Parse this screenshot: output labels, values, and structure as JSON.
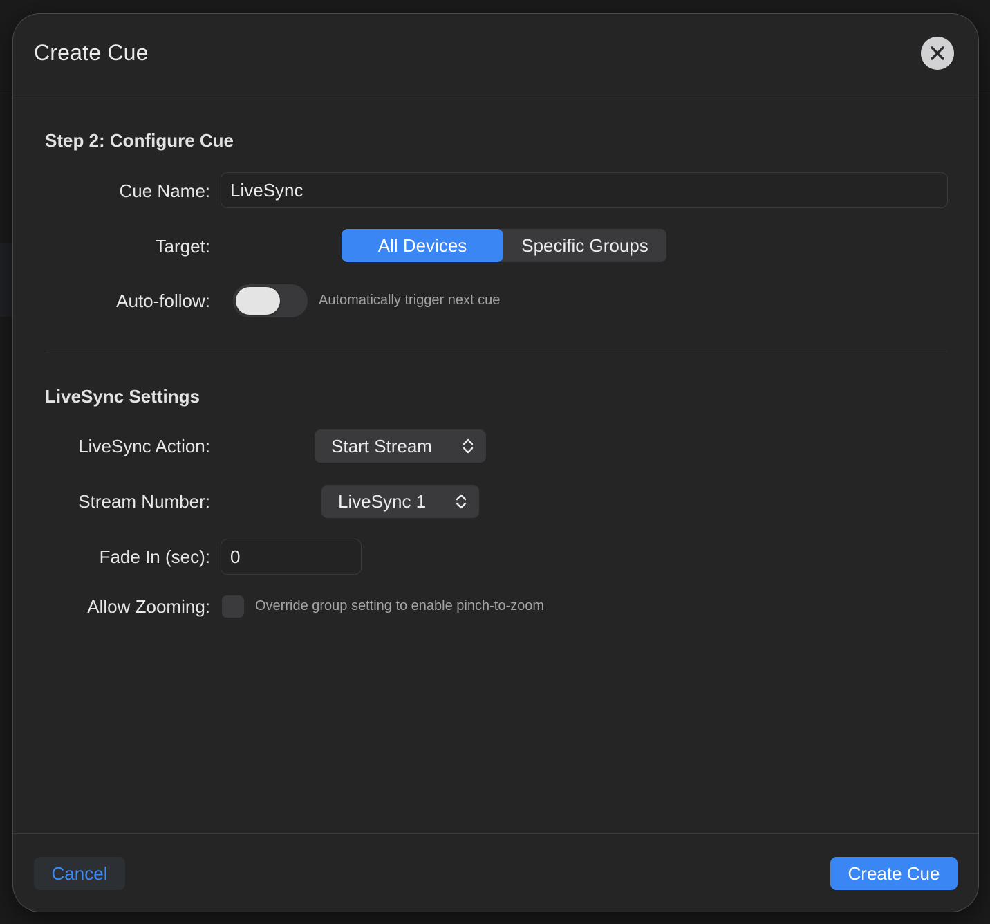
{
  "dialog": {
    "title": "Create Cue",
    "close_icon": "close-icon"
  },
  "configure": {
    "section_title": "Step 2: Configure Cue",
    "cue_name_label": "Cue Name:",
    "cue_name_value": "LiveSync",
    "target_label": "Target:",
    "target_options": [
      "All Devices",
      "Specific Groups"
    ],
    "target_selected": "All Devices",
    "autofollow_label": "Auto-follow:",
    "autofollow_on": false,
    "autofollow_hint": "Automatically trigger next cue"
  },
  "livesync": {
    "section_title": "LiveSync Settings",
    "action_label": "LiveSync Action:",
    "action_value": "Start Stream",
    "stream_label": "Stream Number:",
    "stream_value": "LiveSync 1",
    "fade_label": "Fade In (sec):",
    "fade_value": "0",
    "zoom_label": "Allow Zooming:",
    "zoom_checked": false,
    "zoom_hint": "Override group setting to enable pinch-to-zoom"
  },
  "footer": {
    "cancel_label": "Cancel",
    "create_label": "Create Cue"
  },
  "colors": {
    "accent": "#3b86f5",
    "background": "#252525",
    "text": "#e6e6e7",
    "hint": "#a4a4a7"
  }
}
